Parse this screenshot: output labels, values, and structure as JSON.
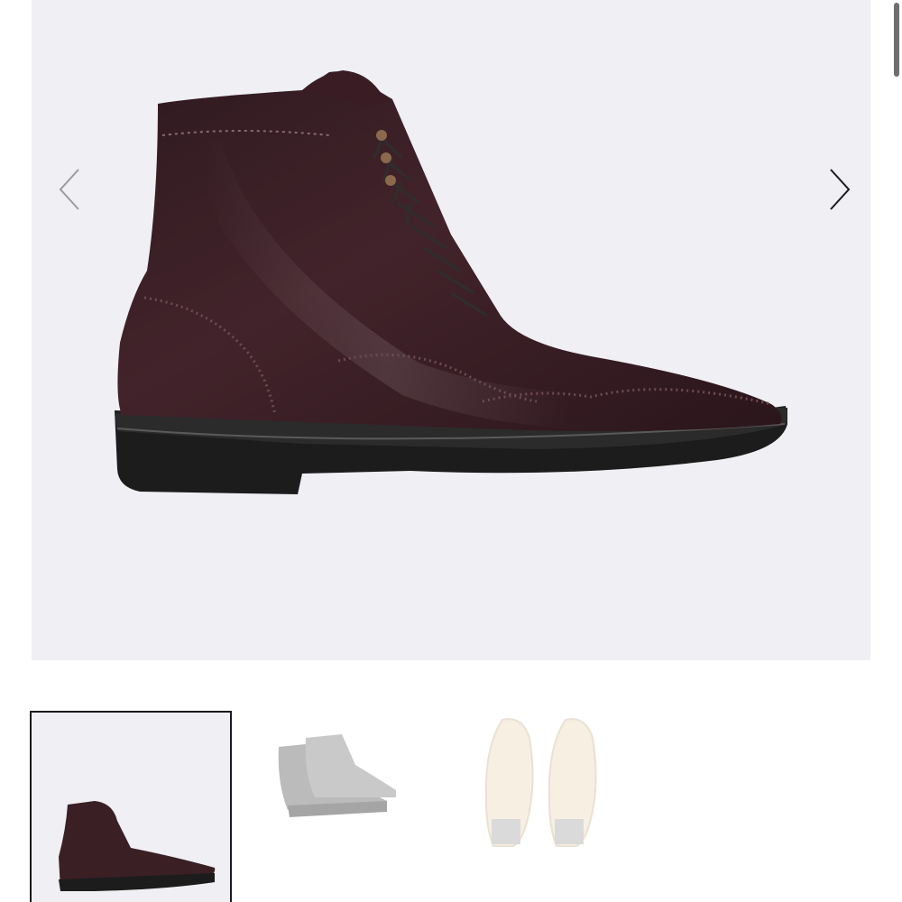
{
  "gallery": {
    "main_image_icon": "brogue-boot-side-view",
    "prev_icon": "chevron-left-icon",
    "next_icon": "chevron-right-icon",
    "thumbnails": [
      {
        "icon": "boot-side-thumbnail",
        "selected": true
      },
      {
        "icon": "boot-pair-thumbnail",
        "selected": false
      },
      {
        "icon": "boot-soles-thumbnail",
        "selected": false
      }
    ]
  },
  "colors": {
    "hero_bg": "#efeff4",
    "leather": "#3a1f25",
    "sole": "#1c1c1c",
    "selected_border": "#1a1a1a"
  }
}
